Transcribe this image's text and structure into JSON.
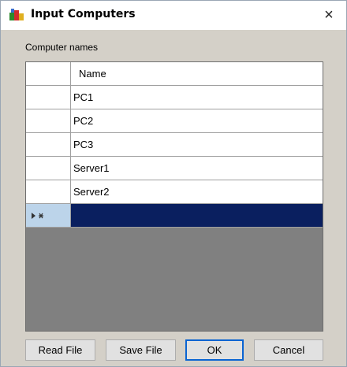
{
  "window": {
    "title": "Input Computers",
    "close_glyph": "×",
    "icon": "app-icon"
  },
  "section_label": "Computer names",
  "grid": {
    "column_header": "Name",
    "rows": [
      "PC1",
      "PC2",
      "PC3",
      "Server1",
      "Server2"
    ],
    "new_row_marker": "new-row-indicator-icon",
    "empty_area_color": "#808080",
    "selection_color": "#0a1f5f"
  },
  "buttons": {
    "read_file": "Read File",
    "save_file": "Save File",
    "ok": "OK",
    "cancel": "Cancel"
  },
  "colors": {
    "default_button_border": "#0a64d2"
  }
}
